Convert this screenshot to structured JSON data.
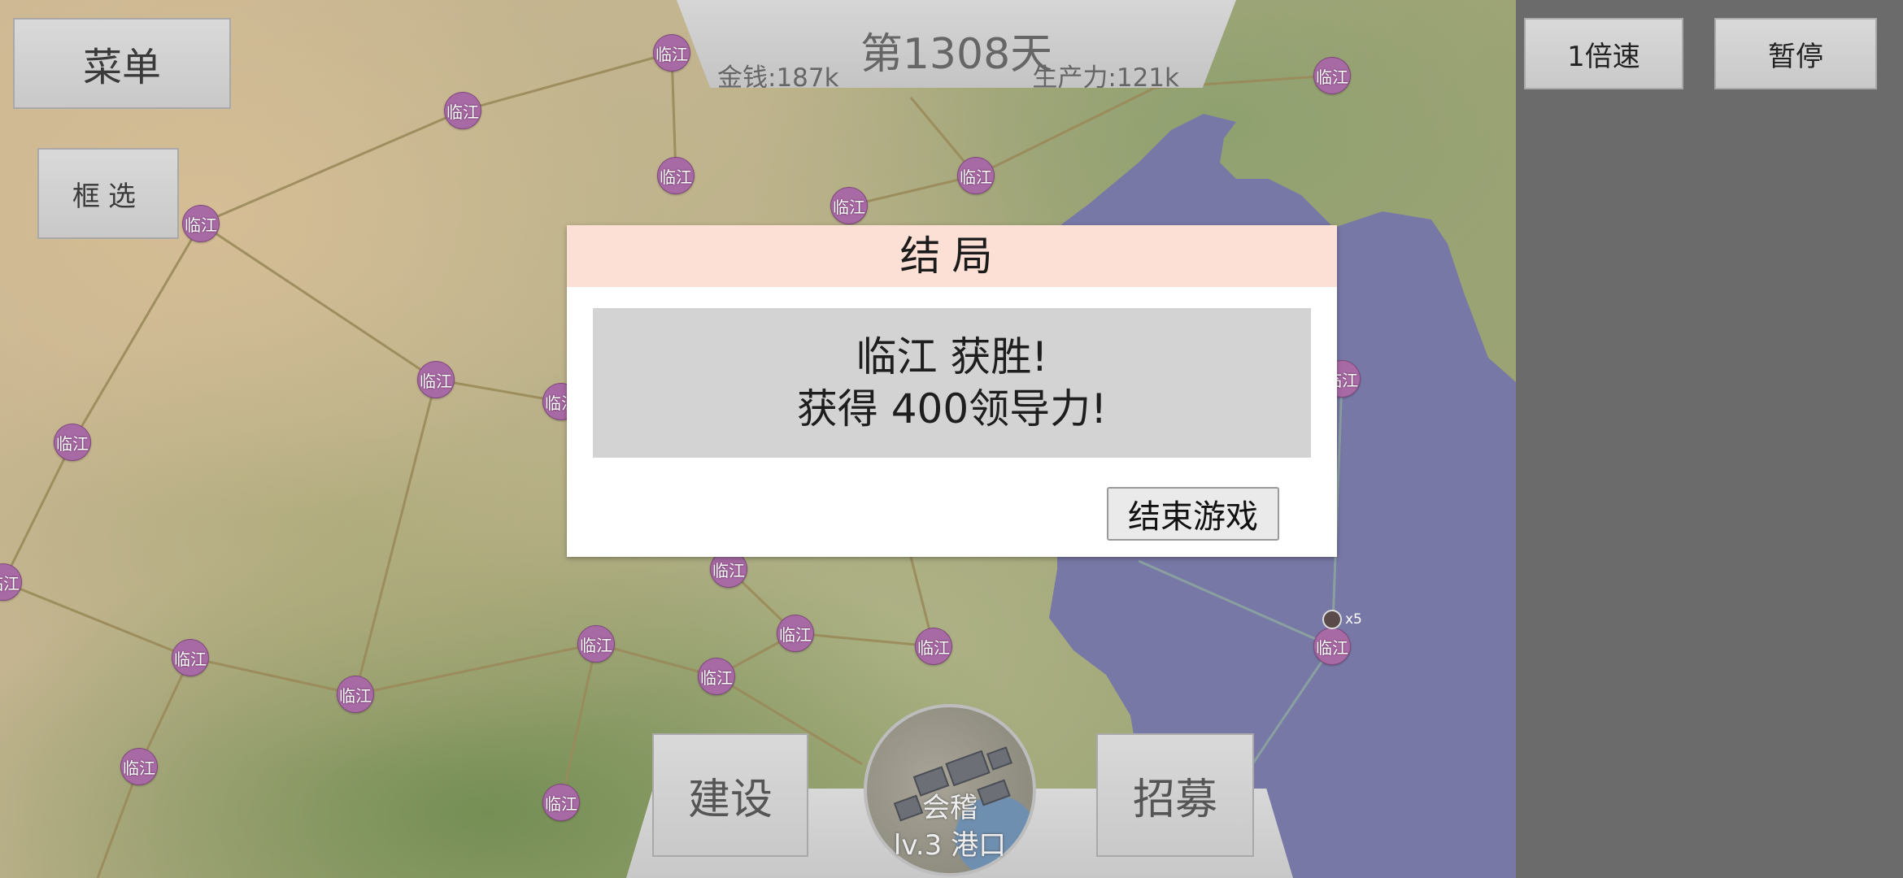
{
  "hud": {
    "menu_label": "菜单",
    "select_label": "框选",
    "day_label": "第1308天",
    "money_label": "金钱:187k",
    "productivity_label": "生产力:121k",
    "speed_label": "1倍速",
    "pause_label": "暂停"
  },
  "map": {
    "city_labels": [
      "临江",
      "临江",
      "临江",
      "临江",
      "临江",
      "临江",
      "临江",
      "临江",
      "临江",
      "临江",
      "临江",
      "临江",
      "临江",
      "临江",
      "临江",
      "临江",
      "临江",
      "临江",
      "临江",
      "临江",
      "临江",
      "临江"
    ],
    "fleet_count": "x5",
    "colors": {
      "sea": "#7878a6",
      "node": "#a86aa4",
      "road": "#9a8a5a",
      "sea_route": "#8aa0a0"
    }
  },
  "dialog": {
    "title": "结局",
    "message_line1": "临江 获胜!",
    "message_line2": "获得 400领导力!",
    "end_button": "结束游戏",
    "header_color": "#fde0d5"
  },
  "bottom": {
    "build_label": "建设",
    "recruit_label": "招募",
    "city_name": "会稽",
    "city_level": "lv.3 港口"
  }
}
